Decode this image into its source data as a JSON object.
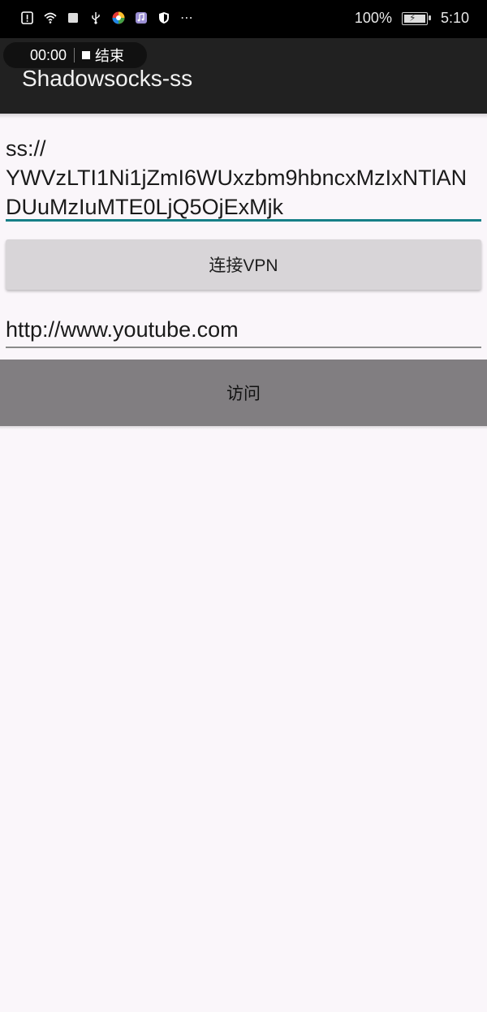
{
  "status_bar": {
    "battery_text": "100%",
    "time": "5:10",
    "more_icon": "⋯",
    "icons": [
      "alert-icon",
      "wifi-icon",
      "square-icon",
      "usb-icon",
      "colorful-app-icon",
      "music-icon",
      "shield-icon",
      "more-icon"
    ]
  },
  "screen_record": {
    "time": "00:00",
    "end_label": "结束"
  },
  "app_bar": {
    "title": "Shadowsocks-ss"
  },
  "ss_field": {
    "value": "ss://\nYWVzLTI1Ni1jZmI6WUxzbm9hbncxMzIxNTlANDUuMzIuMTE0LjQ5OjExMjk"
  },
  "connect_button": {
    "label": "连接VPN"
  },
  "url_field": {
    "value": "http://www.youtube.com"
  },
  "visit_button": {
    "label": "访问"
  },
  "colors": {
    "accent_underline": "#167f87",
    "app_bar": "#212121",
    "background": "#faf6fa"
  }
}
